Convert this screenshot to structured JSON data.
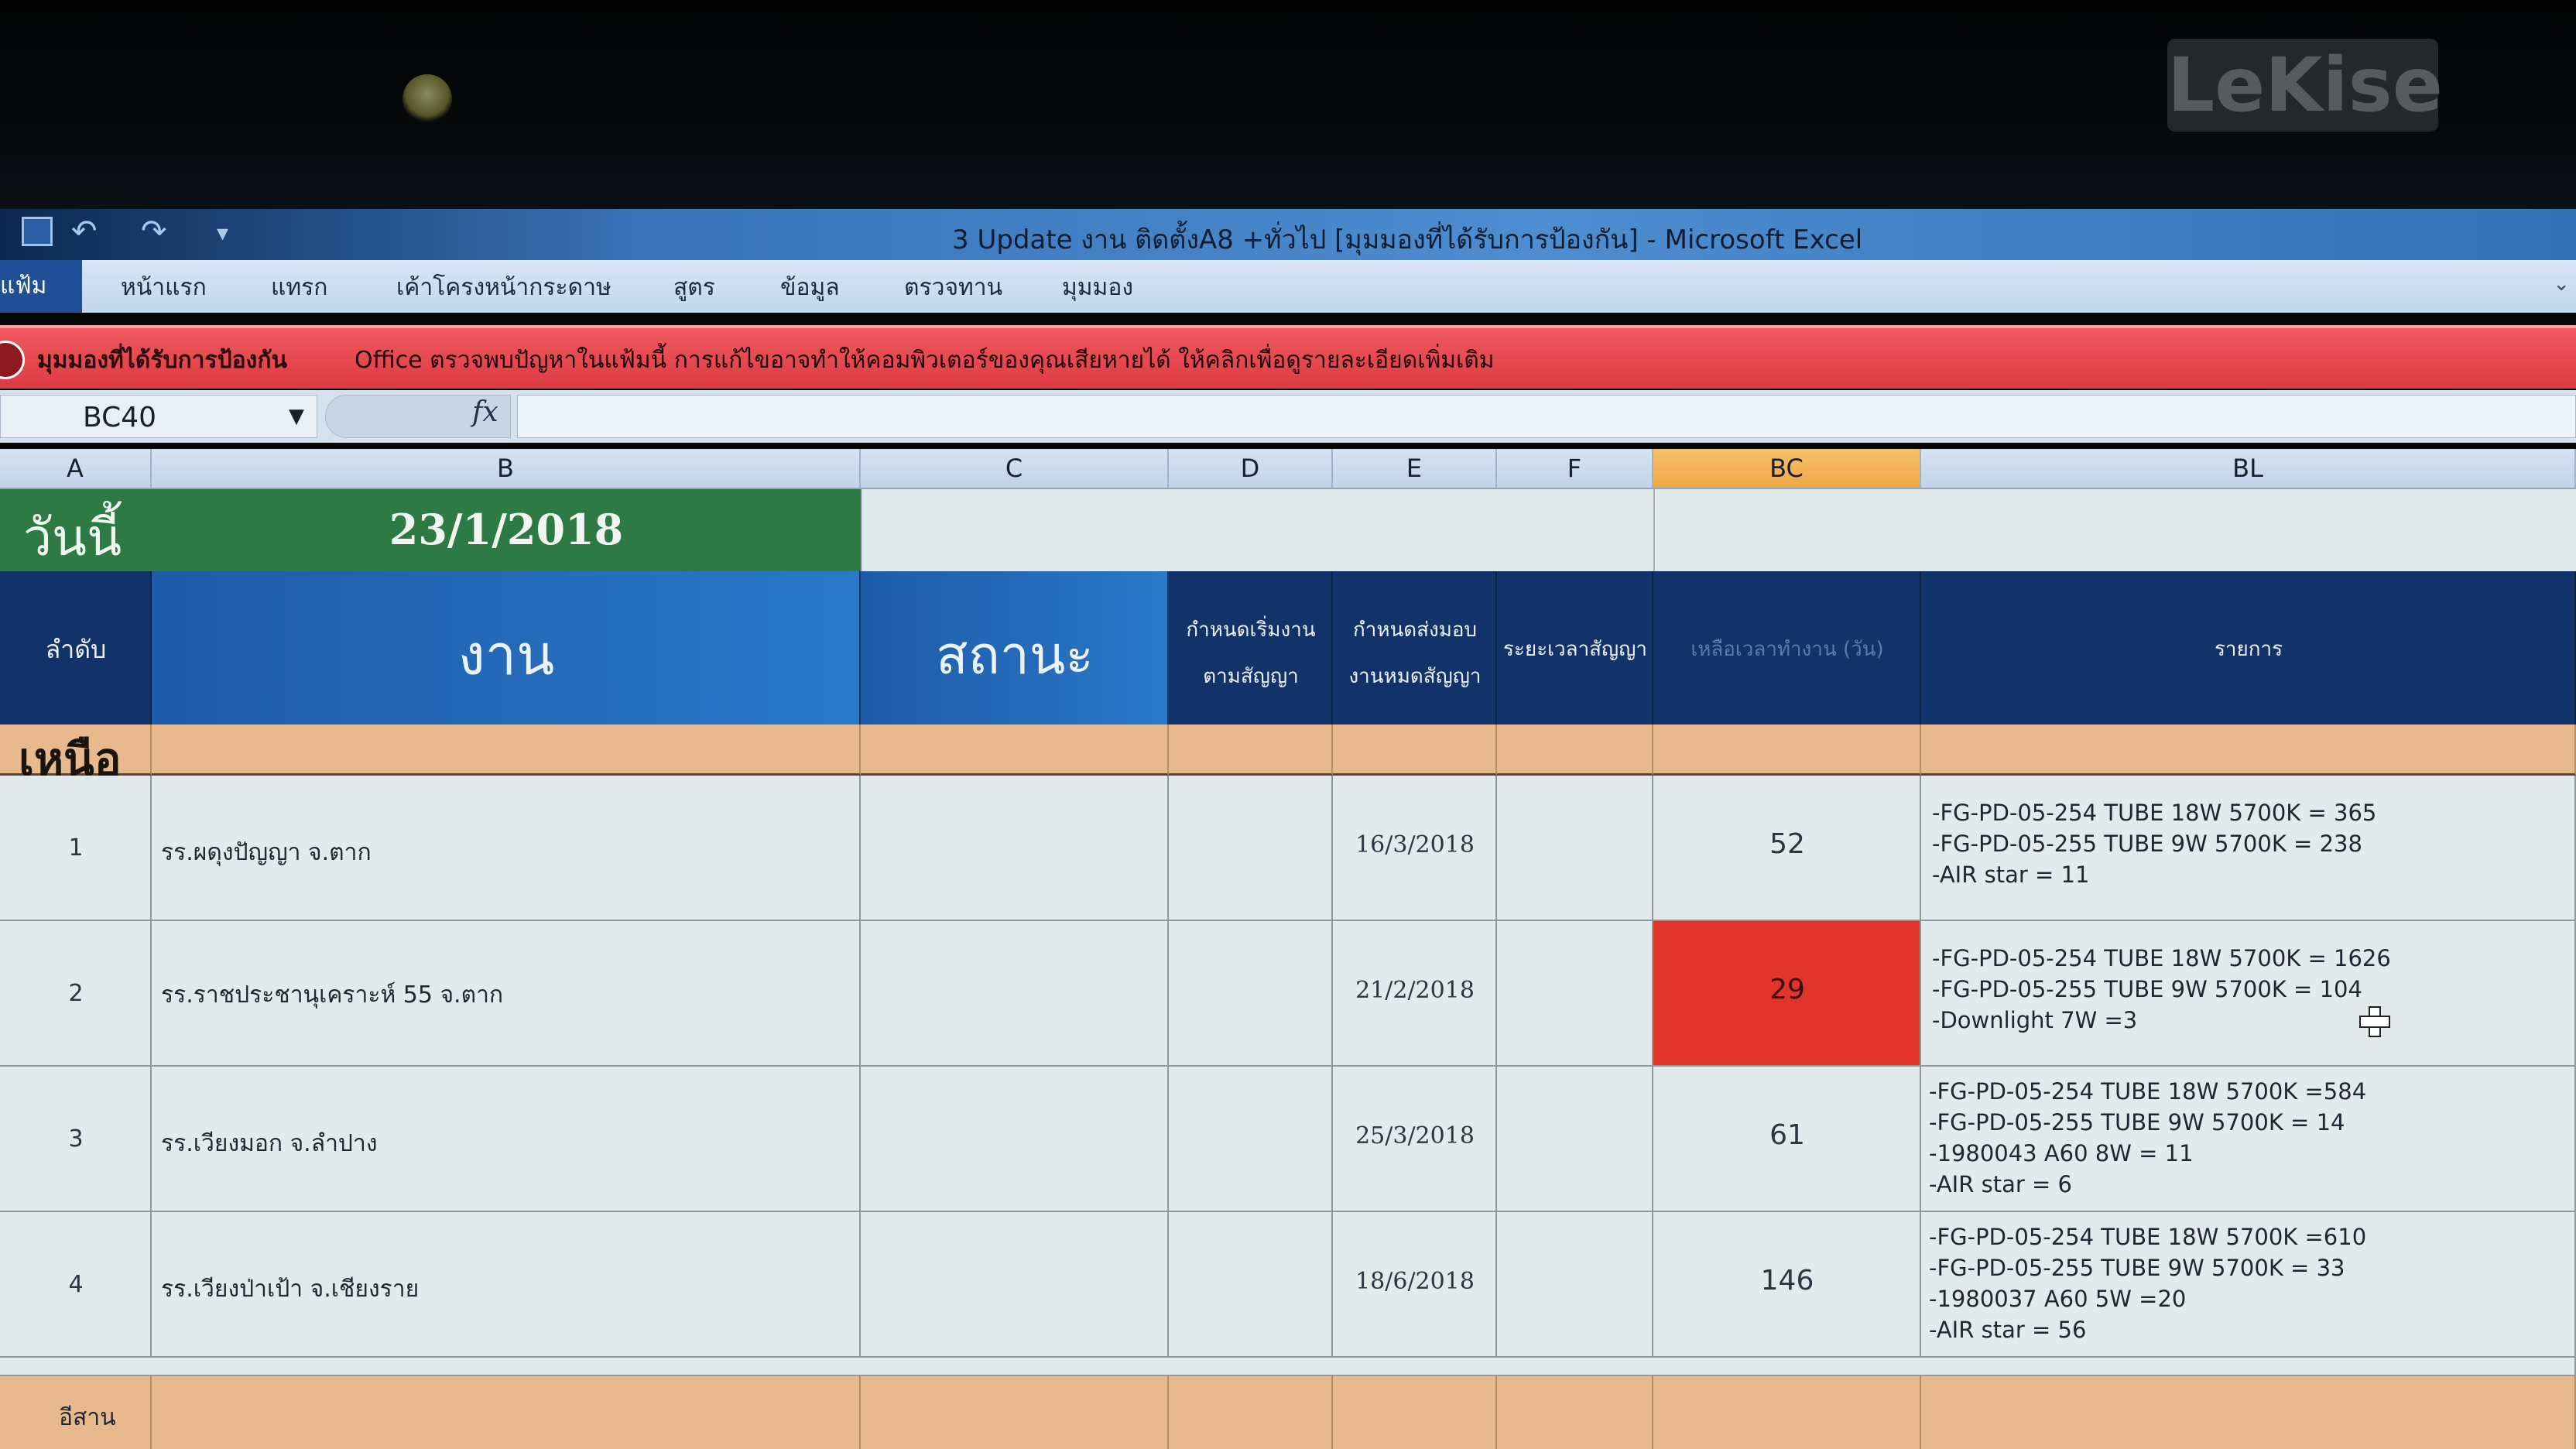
{
  "background": {
    "logo_text": "LeKise"
  },
  "window": {
    "title": "3 Update งาน ติดตั้งA8 +ทั่วไป [มุมมองที่ได้รับการป้องกัน] - Microsoft Excel"
  },
  "qat": {
    "undo": "↶",
    "redo": "↷",
    "more": "▾"
  },
  "ribbon": {
    "tabs": [
      "แฟ้ม",
      "หน้าแรก",
      "แทรก",
      "เค้าโครงหน้ากระดาษ",
      "สูตร",
      "ข้อมูล",
      "ตรวจทาน",
      "มุมมอง"
    ]
  },
  "protected_view": {
    "title": "มุมมองที่ได้รับการป้องกัน",
    "message": "Office ตรวจพบปัญหาในแฟ้มนี้ การแก้ไขอาจทำให้คอมพิวเตอร์ของคุณเสียหายได้ ให้คลิกเพื่อดูรายละเอียดเพิ่มเติม"
  },
  "formula_bar": {
    "name_box": "BC40",
    "fx": "fx",
    "value": ""
  },
  "columns": {
    "headers": [
      "A",
      "B",
      "C",
      "D",
      "E",
      "F",
      "BC",
      "BL"
    ],
    "active": "BC"
  },
  "sheet": {
    "today_label": "วันนี้",
    "today_date": "23/1/2018",
    "headers": {
      "seq": "ลำดับ",
      "work": "งาน",
      "status": "สถานะ",
      "start": "กำหนดเริ่มงาน ตามสัญญา",
      "deliver": "กำหนดส่งมอบ งานหมดสัญญา",
      "period": "ระยะเวลาสัญญา",
      "remaining": "เหลือเวลาทำงาน (วัน)",
      "items": "รายการ"
    },
    "region_north": "เหนือ",
    "region_next": "อีสาน",
    "rows": [
      {
        "seq": "1",
        "work": "รร.ผดุงปัญญา จ.ตาก",
        "deliver": "16/3/2018",
        "remaining": "52",
        "items": [
          "-FG-PD-05-254 TUBE 18W 5700K = 365",
          "-FG-PD-05-255 TUBE 9W 5700K = 238",
          "-AIR star = 11"
        ]
      },
      {
        "seq": "2",
        "work": "รร.ราชประชานุเคราะห์ 55 จ.ตาก",
        "deliver": "21/2/2018",
        "remaining": "29",
        "items": [
          "-FG-PD-05-254 TUBE 18W 5700K = 1626",
          "-FG-PD-05-255 TUBE 9W 5700K = 104",
          "-Downlight 7W =3"
        ]
      },
      {
        "seq": "3",
        "work": "รร.เวียงมอก จ.ลำปาง",
        "deliver": "25/3/2018",
        "remaining": "61",
        "items": [
          "-FG-PD-05-254 TUBE 18W 5700K =584",
          "-FG-PD-05-255 TUBE 9W 5700K = 14",
          "-1980043 A60 8W = 11",
          "-AIR star = 6"
        ]
      },
      {
        "seq": "4",
        "work": "รร.เวียงป่าเป้า จ.เชียงราย",
        "deliver": "18/6/2018",
        "remaining": "146",
        "items": [
          "-FG-PD-05-254 TUBE 18W 5700K =610",
          "-FG-PD-05-255 TUBE 9W 5700K = 33",
          "-1980037 A60 5W =20",
          "-AIR star = 56"
        ]
      }
    ]
  },
  "colors": {
    "ribbon_file": "#1f4f95",
    "protected_bar": "#e5434a",
    "today_band": "#2e7a45",
    "header_navy": "#14326a",
    "region_row": "#e7b98c",
    "alert_cell": "#e0342d",
    "active_column": "#f0a845"
  }
}
